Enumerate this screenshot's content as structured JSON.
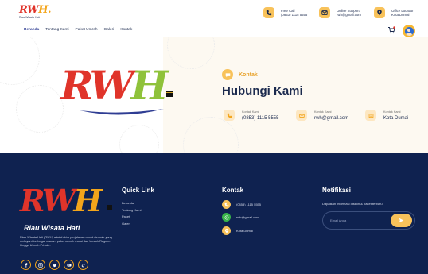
{
  "brand": {
    "logo_letters": [
      "R",
      "W",
      "H"
    ],
    "logo_dot": ".",
    "tagline": "Riau Wisata Hati",
    "footer_name": "Riau Wisata Hati",
    "footer_description": "Riau Wisata Hati (RWH) adalah biro perjalanan umroh terbaik yang melayani berbagai macam paket umroh mulai dari Umroh Reguler hingga Umroh Private."
  },
  "header": {
    "contacts": [
      {
        "title": "Free Call",
        "value": "(0853) 1115 5555",
        "icon": "phone-icon"
      },
      {
        "title": "Online Support",
        "value": "rwh@gmail.com",
        "icon": "mail-icon"
      },
      {
        "title": "Office Location",
        "value": "Kota Dumai",
        "icon": "location-icon"
      }
    ]
  },
  "nav": {
    "items": [
      "Beranda",
      "Tentang Kami",
      "Paket Umroh",
      "Galeri",
      "Kontak"
    ],
    "active_index": 0
  },
  "hero": {
    "tag": "Kontak",
    "title": "Hubungi Kami",
    "info": [
      {
        "title": "Kontak Kami",
        "value": "(0853) 1115 5555",
        "icon": "phone-icon"
      },
      {
        "title": "Kontak Kami",
        "value": "rwh@gmail.com",
        "icon": "mail-icon"
      },
      {
        "title": "Kontak Kami",
        "value": "Kota Dumai",
        "icon": "location-icon"
      }
    ]
  },
  "footer": {
    "quick_link": {
      "heading": "Quick Link",
      "items": [
        "Beranda",
        "Tentang Kami",
        "Paket",
        "Galeri"
      ]
    },
    "kontak": {
      "heading": "Kontak",
      "items": [
        {
          "value": "(0853) 1115 5555",
          "icon": "phone-icon",
          "color": "#f8c25a"
        },
        {
          "value": "rwh@gmail.com",
          "icon": "whatsapp-icon",
          "color": "#38b54a"
        },
        {
          "value": "Kota Dumai",
          "icon": "location-icon",
          "color": "#f8c25a"
        }
      ]
    },
    "notifikasi": {
      "heading": "Notifikasi",
      "description": "Dapatkan informasi diskon & paket terbaru",
      "input_placeholder": "Email Anda",
      "submit_icon": "send-icon"
    },
    "socials": [
      "facebook-icon",
      "instagram-icon",
      "twitter-icon",
      "youtube-icon",
      "tiktok-icon"
    ]
  },
  "colors": {
    "accent": "#f8c25a",
    "navy": "#0f2250",
    "logo_red": "#e0342a",
    "logo_green": "#8fc23a",
    "logo_orange": "#f3a51b"
  }
}
